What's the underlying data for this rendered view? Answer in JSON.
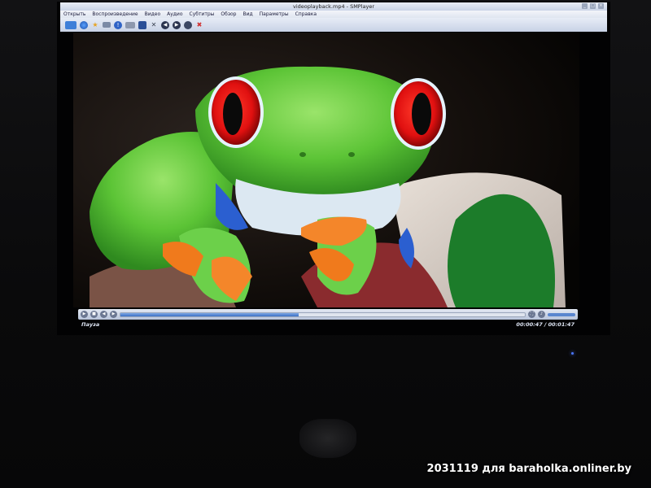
{
  "window": {
    "title": "videoplayback.mp4 - SMPlayer",
    "controls": [
      "_",
      "□",
      "×"
    ]
  },
  "menu": {
    "items": [
      "Открыть",
      "Воспроизведение",
      "Видео",
      "Аудио",
      "Субтитры",
      "Обзор",
      "Вид",
      "Параметры",
      "Справка"
    ]
  },
  "toolbar": {
    "icons": [
      "folder-icon",
      "globe-icon",
      "star-icon",
      "screen-icon",
      "info-icon",
      "playlist-icon",
      "fullscreen-icon",
      "settings-icon",
      "rewind-icon",
      "forward-icon",
      "subtitle-icon",
      "record-icon"
    ]
  },
  "status": {
    "state": "Пауза",
    "time": "00:00:47 / 00:01:47",
    "progress": 0.44
  },
  "colors": {
    "accent": "#3a6fc4",
    "led": "#4b77ff"
  },
  "watermark": "2031119 для baraholka.onliner.by"
}
